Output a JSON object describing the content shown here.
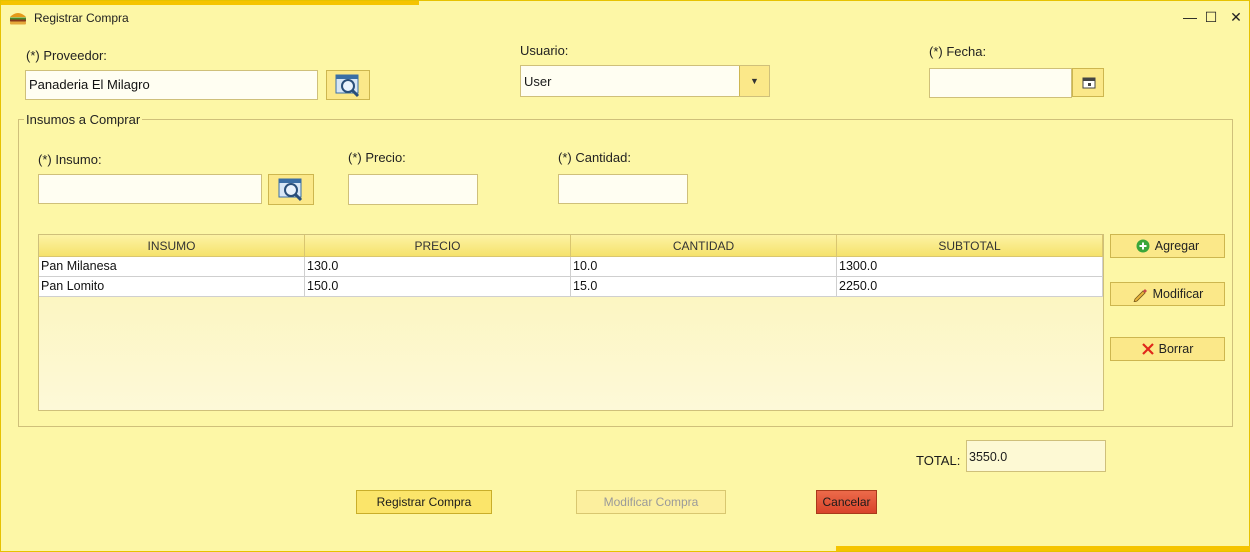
{
  "window": {
    "title": "Registrar Compra",
    "controls": {
      "minimize": "—",
      "maximize": "☐",
      "close": "✕"
    }
  },
  "proveedor": {
    "label": "(*) Proveedor:",
    "value": "Panaderia El Milagro"
  },
  "usuario": {
    "label": "Usuario:",
    "value": "User"
  },
  "fecha": {
    "label": "(*) Fecha:",
    "value": ""
  },
  "group": {
    "title": "Insumos a Comprar"
  },
  "insumo": {
    "label": "(*) Insumo:",
    "value": ""
  },
  "precio": {
    "label": "(*) Precio:",
    "value": ""
  },
  "cantidad": {
    "label": "(*) Cantidad:",
    "value": ""
  },
  "table": {
    "headers": [
      "INSUMO",
      "PRECIO",
      "CANTIDAD",
      "SUBTOTAL"
    ],
    "rows": [
      [
        "Pan Milanesa",
        "130.0",
        "10.0",
        "1300.0"
      ],
      [
        "Pan Lomito",
        "150.0",
        "15.0",
        "2250.0"
      ]
    ]
  },
  "actions": {
    "agregar": "Agregar",
    "modificar": "Modificar",
    "borrar": "Borrar"
  },
  "total": {
    "label": "TOTAL:",
    "value": "3550.0"
  },
  "footer": {
    "registrar": "Registrar Compra",
    "modificar": "Modificar Compra",
    "cancelar": "Cancelar"
  },
  "colors": {
    "background": "#fdf7a6",
    "accent": "#f5c400",
    "cancel": "#e0533a",
    "add_icon": "#3aa63a",
    "delete_icon": "#e0271a"
  }
}
